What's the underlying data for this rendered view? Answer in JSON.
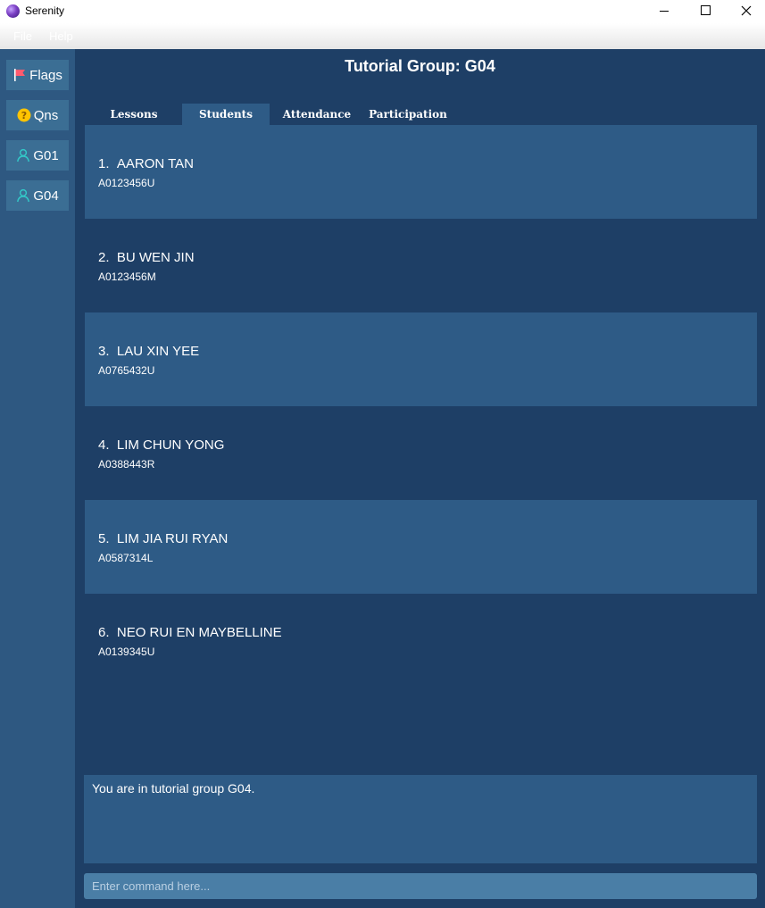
{
  "window": {
    "title": "Serenity"
  },
  "menubar": {
    "items": [
      "File",
      "Help"
    ]
  },
  "sidebar": {
    "items": [
      {
        "label": "Flags",
        "icon": "flag-icon",
        "icon_color": "#ff5a6e"
      },
      {
        "label": "Qns",
        "icon": "question-icon",
        "icon_color": "#ffc400"
      },
      {
        "label": "G01",
        "icon": "person-icon",
        "icon_color": "#33c6c6"
      },
      {
        "label": "G04",
        "icon": "person-icon",
        "icon_color": "#33c6c6"
      }
    ]
  },
  "main": {
    "title": "Tutorial Group: G04",
    "tabs": [
      {
        "label": "Lessons",
        "active": false
      },
      {
        "label": "Students",
        "active": true
      },
      {
        "label": "Attendance",
        "active": false
      },
      {
        "label": "Participation",
        "active": false
      }
    ],
    "students": [
      {
        "index": "1.",
        "name": "AARON TAN",
        "id": "A0123456U"
      },
      {
        "index": "2.",
        "name": "BU WEN JIN",
        "id": "A0123456M"
      },
      {
        "index": "3.",
        "name": "LAU XIN YEE",
        "id": "A0765432U"
      },
      {
        "index": "4.",
        "name": "LIM CHUN YONG",
        "id": "A0388443R"
      },
      {
        "index": "5.",
        "name": "LIM JIA RUI RYAN",
        "id": "A0587314L"
      },
      {
        "index": "6.",
        "name": "NEO RUI EN MAYBELLINE",
        "id": "A0139345U"
      }
    ],
    "result_message": "You are in tutorial group G04.",
    "command_placeholder": "Enter command here..."
  },
  "colors": {
    "sidebar_bg": "#2e5881",
    "main_bg": "#1e3f66",
    "card_bg": "#2e5b86",
    "sidebar_button_bg": "#3b6e94",
    "command_bg": "#4a7ea6"
  }
}
